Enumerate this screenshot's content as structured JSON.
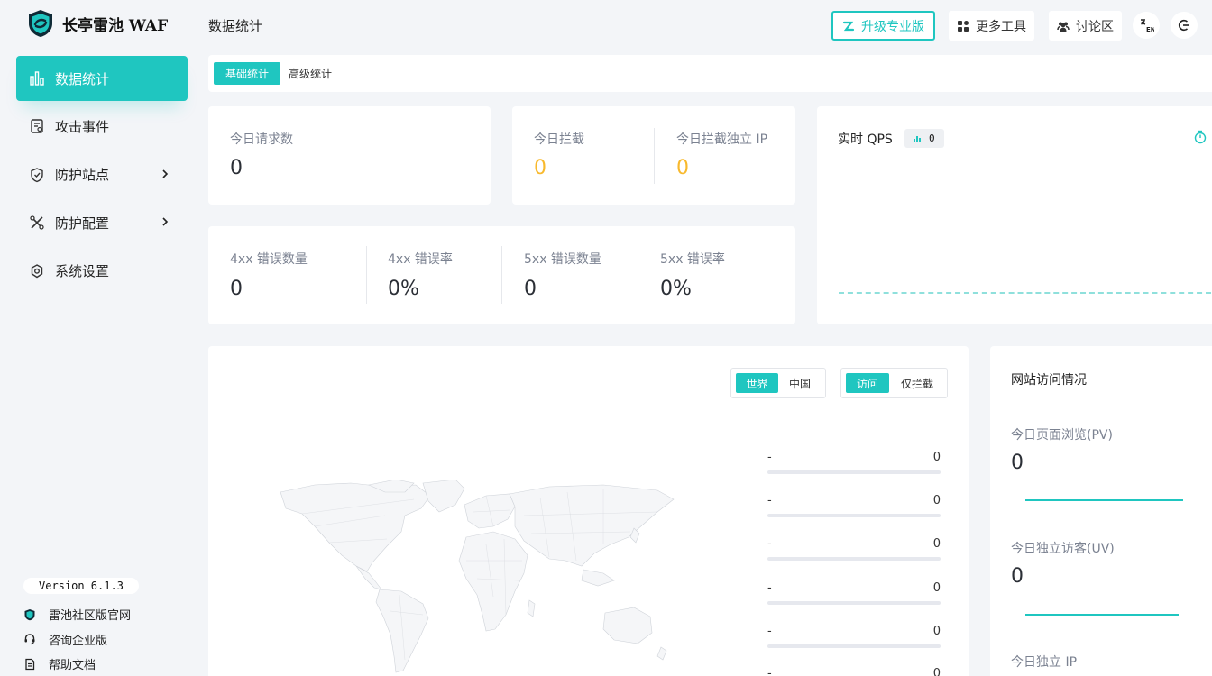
{
  "app": {
    "name": "长亭雷池 WAF",
    "version": "Version 6.1.3"
  },
  "sidebar": {
    "items": [
      {
        "label": "数据统计",
        "icon": "bar-chart-icon",
        "active": true
      },
      {
        "label": "攻击事件",
        "icon": "document-icon"
      },
      {
        "label": "防护站点",
        "icon": "shield-icon",
        "has_children": true
      },
      {
        "label": "防护配置",
        "icon": "tools-icon",
        "has_children": true
      },
      {
        "label": "系统设置",
        "icon": "gear-icon"
      }
    ],
    "footer_links": [
      {
        "label": "雷池社区版官网",
        "icon": "logo-shield-icon"
      },
      {
        "label": "咨询企业版",
        "icon": "headset-icon"
      },
      {
        "label": "帮助文档",
        "icon": "file-icon"
      }
    ]
  },
  "header": {
    "title": "数据统计",
    "upgrade_label": "升级专业版",
    "more_tools_label": "更多工具",
    "forum_label": "讨论区"
  },
  "tabs": [
    {
      "label": "基础统计",
      "active": true
    },
    {
      "label": "高级统计",
      "active": false
    }
  ],
  "stats": {
    "today_requests": {
      "label": "今日请求数",
      "value": "0"
    },
    "today_blocked": {
      "label": "今日拦截",
      "value": "0"
    },
    "today_blocked_ip": {
      "label": "今日拦截独立 IP",
      "value": "0"
    },
    "err4xx_count": {
      "label": "4xx 错误数量",
      "value": "0"
    },
    "err4xx_rate": {
      "label": "4xx 错误率",
      "value": "0%"
    },
    "err5xx_count": {
      "label": "5xx 错误数量",
      "value": "0"
    },
    "err5xx_rate": {
      "label": "5xx 错误率",
      "value": "0%"
    }
  },
  "qps": {
    "title": "实时 QPS",
    "value": "0"
  },
  "map": {
    "region_options": [
      "世界",
      "中国"
    ],
    "region_selected": "世界",
    "mode_options": [
      "访问",
      "仅拦截"
    ],
    "mode_selected": "访问",
    "ranking": [
      {
        "name": "-",
        "value": "0"
      },
      {
        "name": "-",
        "value": "0"
      },
      {
        "name": "-",
        "value": "0"
      },
      {
        "name": "-",
        "value": "0"
      },
      {
        "name": "-",
        "value": "0"
      },
      {
        "name": "-",
        "value": "0"
      }
    ]
  },
  "site_visits": {
    "title": "网站访问情况",
    "pv": {
      "label": "今日页面浏览(PV)",
      "value": "0"
    },
    "uv": {
      "label": "今日独立访客(UV)",
      "value": "0"
    },
    "ip_label": "今日独立 IP"
  },
  "colors": {
    "accent": "#1fc6c0",
    "warning": "#f8b92d"
  }
}
